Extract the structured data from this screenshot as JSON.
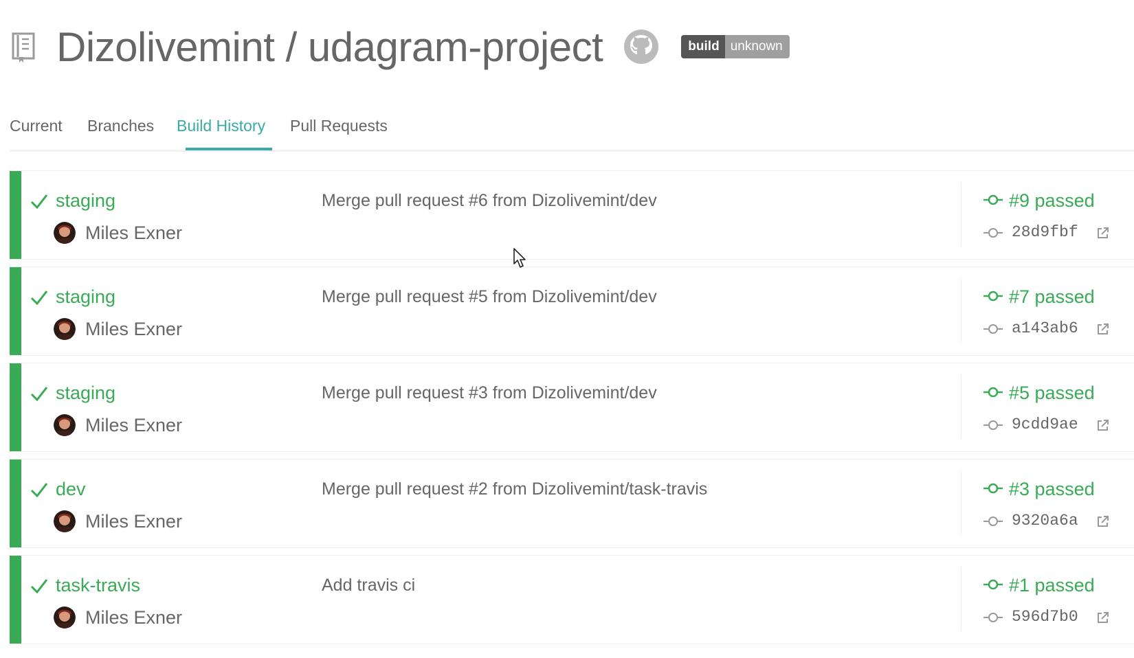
{
  "header": {
    "title": "Dizolivemint / udagram-project",
    "badge": {
      "left": "build",
      "right": "unknown"
    }
  },
  "tabs": [
    {
      "label": "Current"
    },
    {
      "label": "Branches"
    },
    {
      "label": "Build History"
    },
    {
      "label": "Pull Requests"
    }
  ],
  "active_tab": "Build History",
  "colors": {
    "passed": "#39aa56",
    "accent": "#39aaa4",
    "text": "#666666"
  },
  "builds": [
    {
      "branch": "staging",
      "author": "Miles Exner",
      "message": "Merge pull request #6 from Dizolivemint/dev",
      "build": "#9 passed",
      "sha": "28d9fbf"
    },
    {
      "branch": "staging",
      "author": "Miles Exner",
      "message": "Merge pull request #5 from Dizolivemint/dev",
      "build": "#7 passed",
      "sha": "a143ab6"
    },
    {
      "branch": "staging",
      "author": "Miles Exner",
      "message": "Merge pull request #3 from Dizolivemint/dev",
      "build": "#5 passed",
      "sha": "9cdd9ae"
    },
    {
      "branch": "dev",
      "author": "Miles Exner",
      "message": "Merge pull request #2 from Dizolivemint/task-travis",
      "build": "#3 passed",
      "sha": "9320a6a"
    },
    {
      "branch": "task-travis",
      "author": "Miles Exner",
      "message": "Add travis ci",
      "build": "#1 passed",
      "sha": "596d7b0"
    }
  ]
}
